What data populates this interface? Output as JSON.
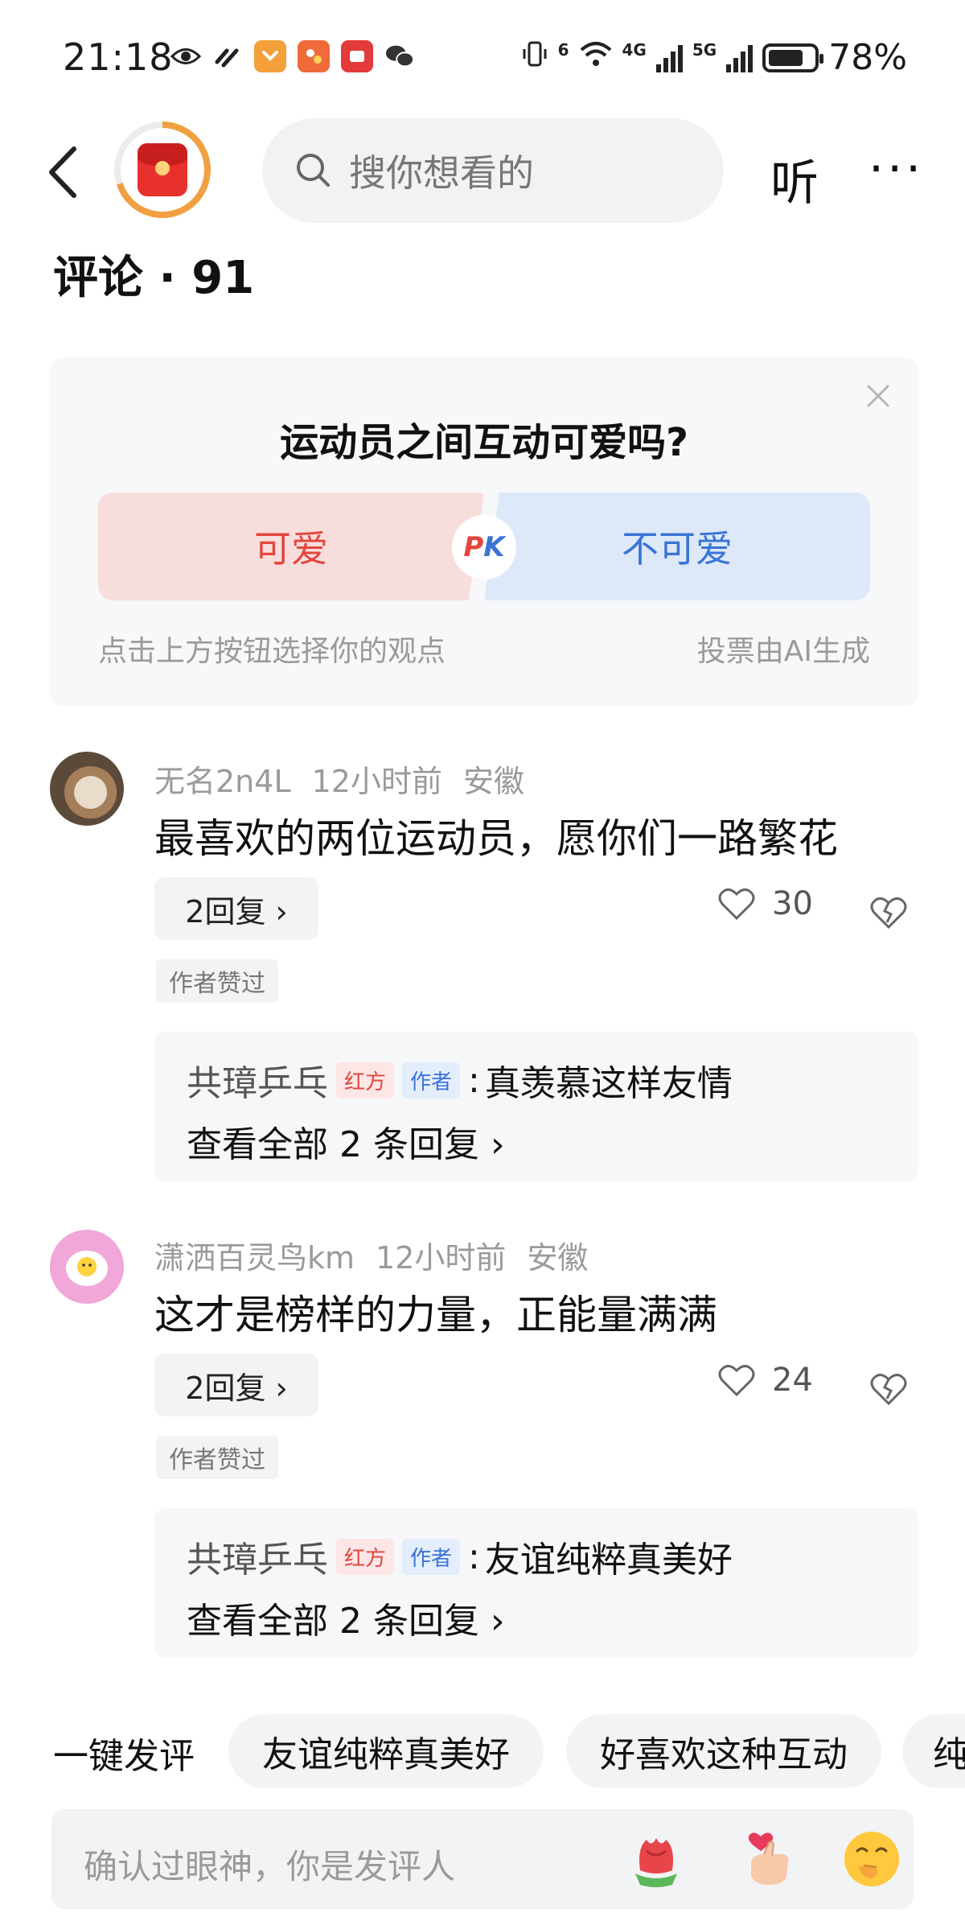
{
  "status_bar": {
    "time": "21:18",
    "signal_a": "6",
    "net_a": "4G",
    "net_b": "5G",
    "battery_pct": "78%",
    "battery_level": 0.78
  },
  "header": {
    "search_placeholder": "搜你想看的",
    "listen_label": "听",
    "more_label": "···"
  },
  "comments_title": "评论 · 91",
  "poll": {
    "question": "运动员之间互动可爱吗?",
    "option_left": "可爱",
    "option_right": "不可爱",
    "pk_p": "P",
    "pk_k": "K",
    "hint": "点击上方按钮选择你的观点",
    "source": "投票由AI生成"
  },
  "comments": [
    {
      "user": "无名2n4L",
      "time": "12小时前",
      "location": "安徽",
      "text": "最喜欢的两位运动员，愿你们一路繁花",
      "reply_btn": "2回复 ›",
      "likes": "30",
      "author_liked": "作者赞过",
      "sub_name": "共璋乒乓",
      "tag_red": "红方",
      "tag_blue": "作者",
      "sub_sep": ":",
      "sub_text": "真羡慕这样友情",
      "view_all": "查看全部 2 条回复 ›"
    },
    {
      "user": "潇洒百灵鸟km",
      "time": "12小时前",
      "location": "安徽",
      "text": "这才是榜样的力量，正能量满满",
      "reply_btn": "2回复 ›",
      "likes": "24",
      "author_liked": "作者赞过",
      "sub_name": "共璋乒乓",
      "tag_red": "红方",
      "tag_blue": "作者",
      "sub_sep": ":",
      "sub_text": "友谊纯粹真美好",
      "view_all": "查看全部 2 条回复 ›"
    }
  ],
  "quick_comment": {
    "label": "一键发评",
    "chips": [
      "友谊纯粹真美好",
      "好喜欢这种互动",
      "纯"
    ]
  },
  "input_bar": {
    "placeholder": "确认过眼神，你是发评人"
  }
}
